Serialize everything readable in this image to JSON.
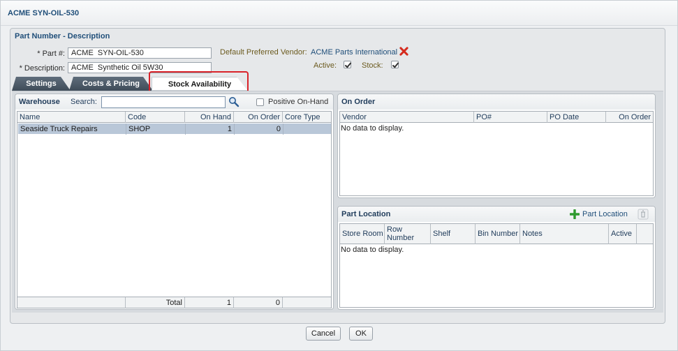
{
  "window": {
    "title": "ACME SYN-OIL-530"
  },
  "header": {
    "section_title": "Part Number - Description",
    "part_label": "* Part #:",
    "part_value": "ACME  SYN-OIL-530",
    "description_label": "* Description:",
    "description_value": "ACME  Synthetic Oil 5W30",
    "vendor_label": "Default Preferred Vendor:",
    "vendor_value": "ACME Parts International",
    "active_label": "Active:",
    "active_checked": true,
    "stock_label": "Stock:",
    "stock_checked": true
  },
  "tabs": [
    {
      "label": "Settings",
      "active": false
    },
    {
      "label": "Costs & Pricing",
      "active": false
    },
    {
      "label": "Stock Availability",
      "active": true
    }
  ],
  "warehouse": {
    "title": "Warehouse",
    "search_label": "Search:",
    "search_value": "",
    "positive_label": "Positive On-Hand",
    "columns": [
      "Name",
      "Code",
      "On Hand",
      "On Order",
      "Core Type"
    ],
    "rows": [
      {
        "name": "Seaside Truck Repairs",
        "code": "SHOP",
        "on_hand": "1",
        "on_order": "0",
        "core_type": ""
      }
    ],
    "total_label": "Total",
    "total_on_hand": "1",
    "total_on_order": "0"
  },
  "on_order": {
    "title": "On Order",
    "columns": [
      "Vendor",
      "PO#",
      "PO Date",
      "On Order"
    ],
    "empty_text": "No data to display."
  },
  "part_location": {
    "title": "Part Location",
    "add_label": "Part Location",
    "columns": [
      "Store Room",
      "Row Number",
      "Shelf",
      "Bin Number",
      "Notes",
      "Active"
    ],
    "empty_text": "No data to display."
  },
  "footer": {
    "cancel_label": "Cancel",
    "ok_label": "OK"
  },
  "colors": {
    "accent": "#1f4e79",
    "highlight": "#d9232a",
    "selected_row": "#b9c7d8"
  }
}
